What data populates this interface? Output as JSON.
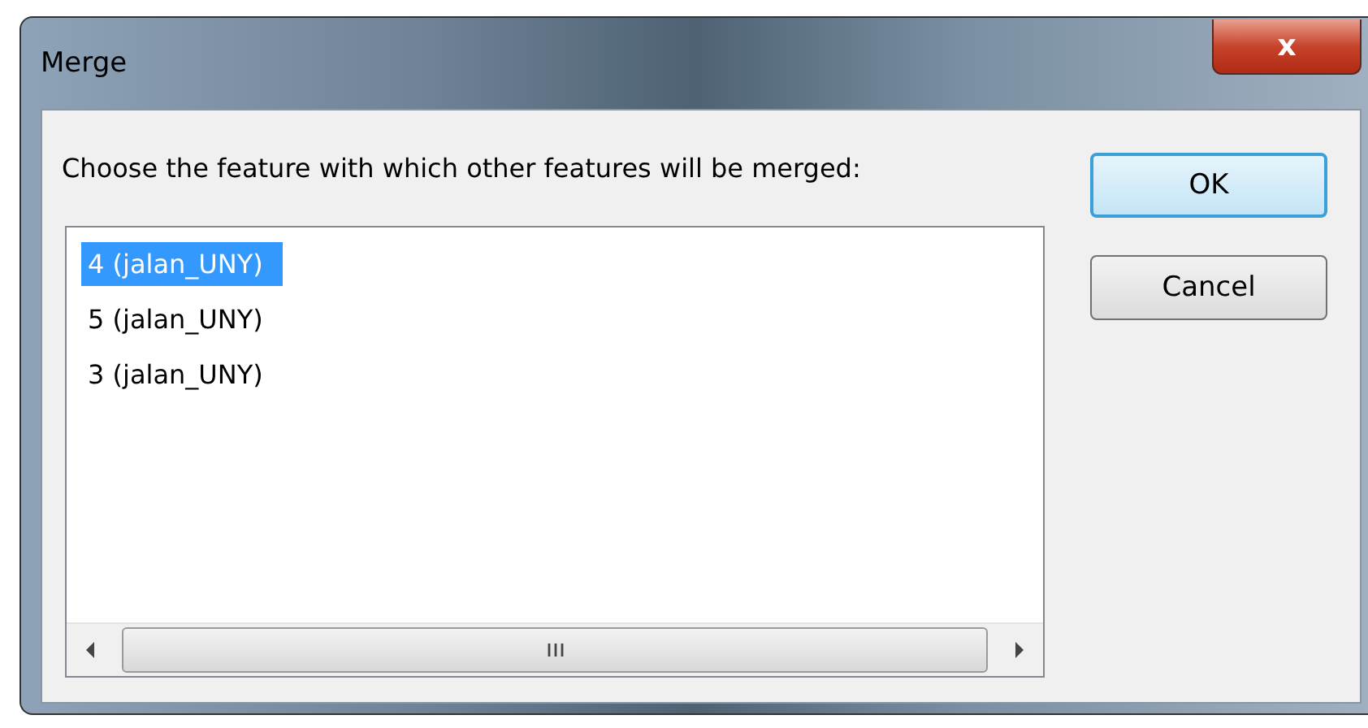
{
  "window": {
    "title": "Merge",
    "close": "x"
  },
  "prompt": "Choose the feature with which other features will be merged:",
  "list": {
    "items": [
      {
        "label": "4 (jalan_UNY)",
        "selected": true
      },
      {
        "label": "5 (jalan_UNY)",
        "selected": false
      },
      {
        "label": "3 (jalan_UNY)",
        "selected": false
      }
    ]
  },
  "buttons": [
    {
      "label": "OK",
      "default": true
    },
    {
      "label": "Cancel",
      "default": false
    }
  ]
}
